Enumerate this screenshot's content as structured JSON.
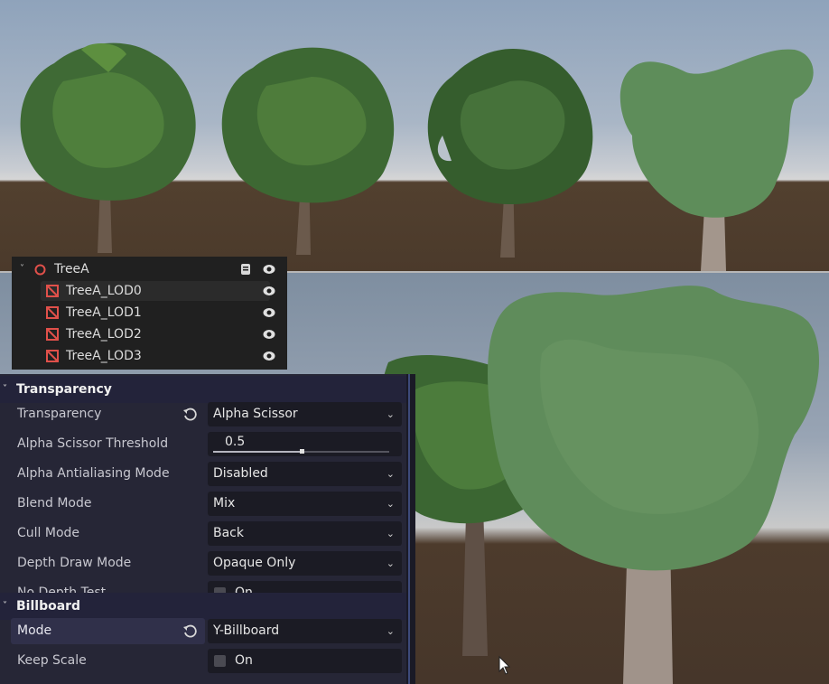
{
  "scene_tree": {
    "root": {
      "label": "TreeA",
      "icon": "node3d-icon"
    },
    "children": [
      {
        "label": "TreeA_LOD0",
        "icon": "mesh-instance-icon",
        "selected": true
      },
      {
        "label": "TreeA_LOD1",
        "icon": "mesh-instance-icon"
      },
      {
        "label": "TreeA_LOD2",
        "icon": "mesh-instance-icon"
      },
      {
        "label": "TreeA_LOD3",
        "icon": "mesh-instance-icon"
      }
    ]
  },
  "inspector": {
    "transparency_section": {
      "title": "Transparency",
      "properties": [
        {
          "name": "Transparency",
          "value": "Alpha Scissor",
          "type": "dropdown",
          "revert": true
        },
        {
          "name": "Alpha Scissor Threshold",
          "value": "0.5",
          "type": "slider",
          "level": 0.5
        },
        {
          "name": "Alpha Antialiasing Mode",
          "value": "Disabled",
          "type": "dropdown"
        },
        {
          "name": "Blend Mode",
          "value": "Mix",
          "type": "dropdown"
        },
        {
          "name": "Cull Mode",
          "value": "Back",
          "type": "dropdown"
        },
        {
          "name": "Depth Draw Mode",
          "value": "Opaque Only",
          "type": "dropdown"
        },
        {
          "name": "No Depth Test",
          "value": "On",
          "type": "checkbox",
          "checked": false
        }
      ]
    },
    "billboard_section": {
      "title": "Billboard",
      "properties": [
        {
          "name": "Mode",
          "value": "Y-Billboard",
          "type": "dropdown",
          "revert": true
        },
        {
          "name": "Keep Scale",
          "value": "On",
          "type": "checkbox",
          "checked": false
        }
      ]
    }
  },
  "colors": {
    "accent_red": "#e0504a",
    "panel_bg": "#262636",
    "foliage": "#5e8a5a"
  }
}
